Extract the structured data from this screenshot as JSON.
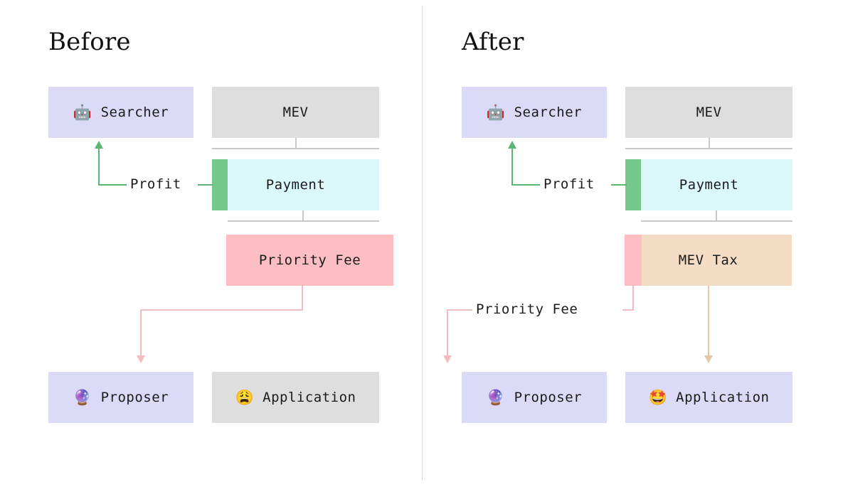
{
  "theme": {
    "background": "#ffffff",
    "divider": "#d8d8d8",
    "bracket": "#c9c9c9",
    "text": "#1b1b1b",
    "lavender": "#dcdbf7",
    "grey": "#dedede",
    "cyan": "#dbf8fb",
    "green": "#74c98a",
    "pink": "#fcbec2",
    "pink_line": "#f3bcc0",
    "tan": "#f5dcc4",
    "tan_line": "#e2c8a6"
  },
  "panels": [
    {
      "id": "before",
      "title": "Before",
      "searcher": {
        "label": "Searcher",
        "emoji": "🤖",
        "emoji_name": "robot-emoji",
        "fill": "#dcdbf7"
      },
      "mev": {
        "label": "MEV",
        "fill": "#dedede"
      },
      "payment": {
        "label": "Payment",
        "fill": "#dbf8fb",
        "sliver_label": "Profit",
        "sliver_fill": "#74c98a",
        "sliver_width": 22
      },
      "fee": {
        "label": "Priority Fee",
        "fill": "#fcbec2",
        "sliver_fill": "#fcbec2",
        "sliver_width": 0
      },
      "proposer": {
        "label": "Proposer",
        "emoji": "🔮",
        "emoji_name": "crystal-ball-emoji",
        "fill": "#dcdbf7"
      },
      "application": {
        "label": "Application",
        "emoji": "😩",
        "emoji_name": "weary-face-emoji",
        "fill": "#dedede"
      },
      "profit_label": "Profit",
      "fee_flow_label": "",
      "fee_target": "proposer",
      "app_receives": false
    },
    {
      "id": "after",
      "title": "After",
      "searcher": {
        "label": "Searcher",
        "emoji": "🤖",
        "emoji_name": "robot-emoji",
        "fill": "#dcdbf7"
      },
      "mev": {
        "label": "MEV",
        "fill": "#dedede"
      },
      "payment": {
        "label": "Payment",
        "fill": "#dbf8fb",
        "sliver_label": "Profit",
        "sliver_fill": "#74c98a",
        "sliver_width": 22
      },
      "fee": {
        "label": "MEV Tax",
        "fill": "#f5dcc4",
        "sliver_fill": "#fcbec2",
        "sliver_width": 24
      },
      "proposer": {
        "label": "Proposer",
        "emoji": "🔮",
        "emoji_name": "crystal-ball-emoji",
        "fill": "#dcdbf7"
      },
      "application": {
        "label": "Application",
        "emoji": "🤩",
        "emoji_name": "star-struck-emoji",
        "fill": "#dcdbf7"
      },
      "profit_label": "Profit",
      "fee_flow_label": "Priority Fee",
      "fee_target": "both",
      "app_receives": true
    }
  ]
}
